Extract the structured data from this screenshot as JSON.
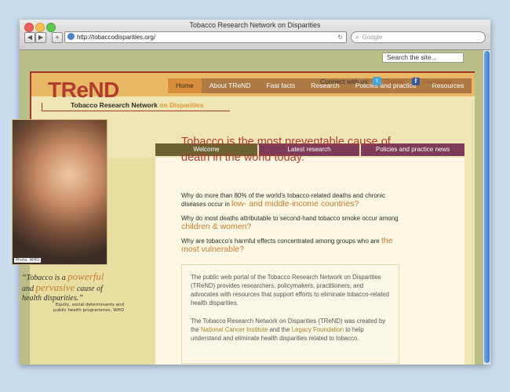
{
  "browser": {
    "window_title": "Tobacco Research Network on Disparities",
    "url": "http://tobaccodisparities.org/",
    "search_placeholder": "Google"
  },
  "site": {
    "search_placeholder": "Search the site...",
    "logo": "TReND",
    "logo_sub": "Tobacco Research Network",
    "logo_sub_accent": "on Disparities",
    "nav": [
      "Home",
      "About TReND",
      "Fast facts",
      "Research",
      "Policies and practice",
      "Resources"
    ],
    "connect_label": "Connect with us:",
    "twitter": "Twitter",
    "facebook": "Facebook",
    "tabs": [
      "Welcome",
      "Latest research",
      "Policies and practice news"
    ]
  },
  "sidebar": {
    "photo_caption": "Photo: WHO",
    "quote_pre": "“Tobacco is a ",
    "quote_w1": "powerful",
    "quote_mid": " and ",
    "quote_w2": "pervasive",
    "quote_post": " cause of health disparities.”",
    "quote_source": "Equity, social determinants and public health programmes, WHO"
  },
  "main": {
    "headline": "Tobacco is the most preventable cause of death in the world today.",
    "q1_text": "Why do more than 80% of the world’s tobacco-related deaths and chronic diseases occur in",
    "q1_em": "low- and middle-income countries?",
    "q2_text": "Why do most deaths attributable to second-hand tobacco smoke occur among",
    "q2_em": "children & women?",
    "q3_text": "Why are tobacco’s harmful effects concentrated among groups who are",
    "q3_em": "the most vulnerable?",
    "intro_p1": "The public web portal of the Tobacco Research Network on Disparities (TReND) provides researchers, policymakers, practitioners, and advocates with resources that support efforts to eliminate tobacco-related health disparities.",
    "intro_p2_a": "The Tobacco Research Network on Disparities (TReND) was created by the",
    "intro_p2_link1": "National Cancer Institute",
    "intro_p2_b": "and the",
    "intro_p2_link2": "Legacy Foundation",
    "intro_p2_c": "to help understand and eliminate health disparities related to tobacco."
  }
}
